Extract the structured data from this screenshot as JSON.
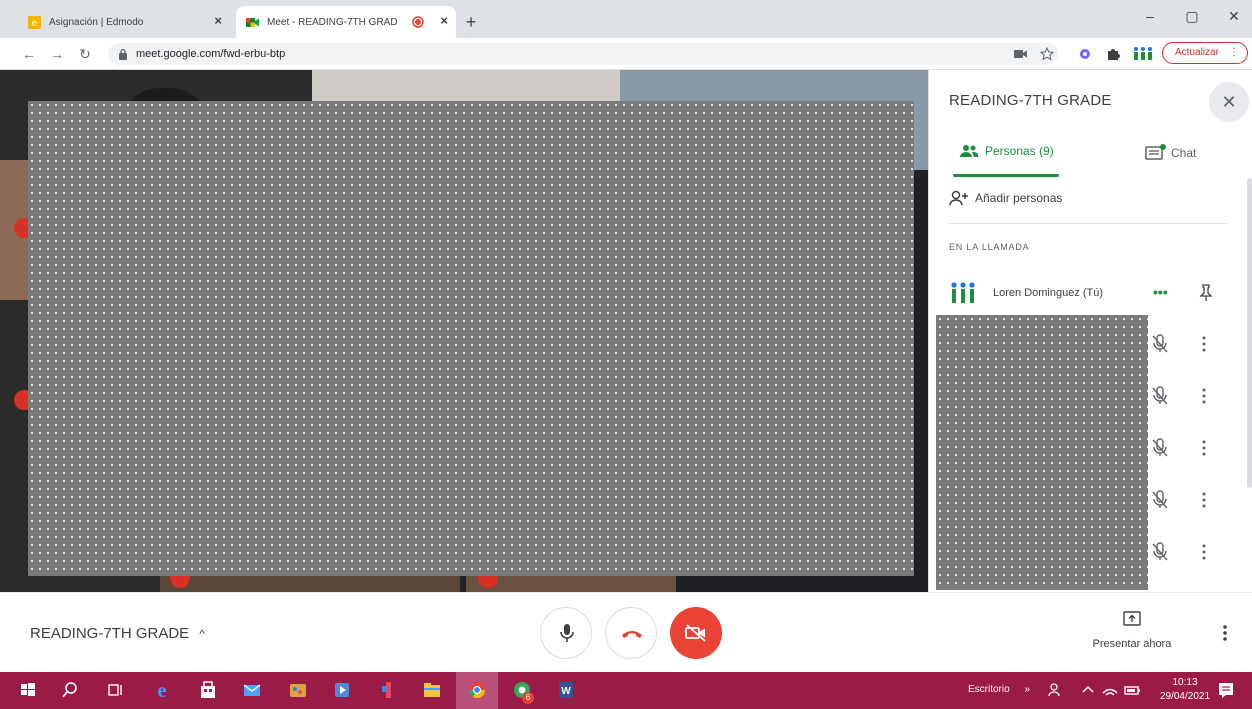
{
  "browser": {
    "tabs": [
      {
        "title": "Asignación | Edmodo",
        "active": false,
        "icon": "edmodo-icon"
      },
      {
        "title": "Meet - READING-7TH GRAD",
        "active": true,
        "icon": "google-meet-icon",
        "recording": true
      }
    ],
    "new_tab": "+",
    "url": "meet.google.com/fwd-erbu-btp",
    "update_label": "Actualizar",
    "window_controls": {
      "minimize": "–",
      "maximize": "▢",
      "close": "✕"
    }
  },
  "panel": {
    "title": "READING-7TH GRADE",
    "tabs": [
      {
        "label": "Personas (9)",
        "active": true,
        "icon": "people-icon"
      },
      {
        "label": "Chat",
        "active": false,
        "icon": "chat-icon"
      }
    ],
    "add_people_label": "Añadir personas",
    "section_header": "EN LA LLAMADA",
    "self": {
      "name": "Loren Dominguez (Tú)",
      "more": "•••"
    }
  },
  "meeting": {
    "title": "READING-7TH GRADE",
    "present_label": "Presentar ahora"
  },
  "taskbar": {
    "desktop_label": "Escritorio",
    "chevron": "»",
    "time": "10:13",
    "date": "29/04/2021",
    "chrome_badge": "6"
  },
  "colors": {
    "accent_green": "#1e8e3e",
    "danger_red": "#ea4335",
    "taskbar": "#9b1b48"
  }
}
